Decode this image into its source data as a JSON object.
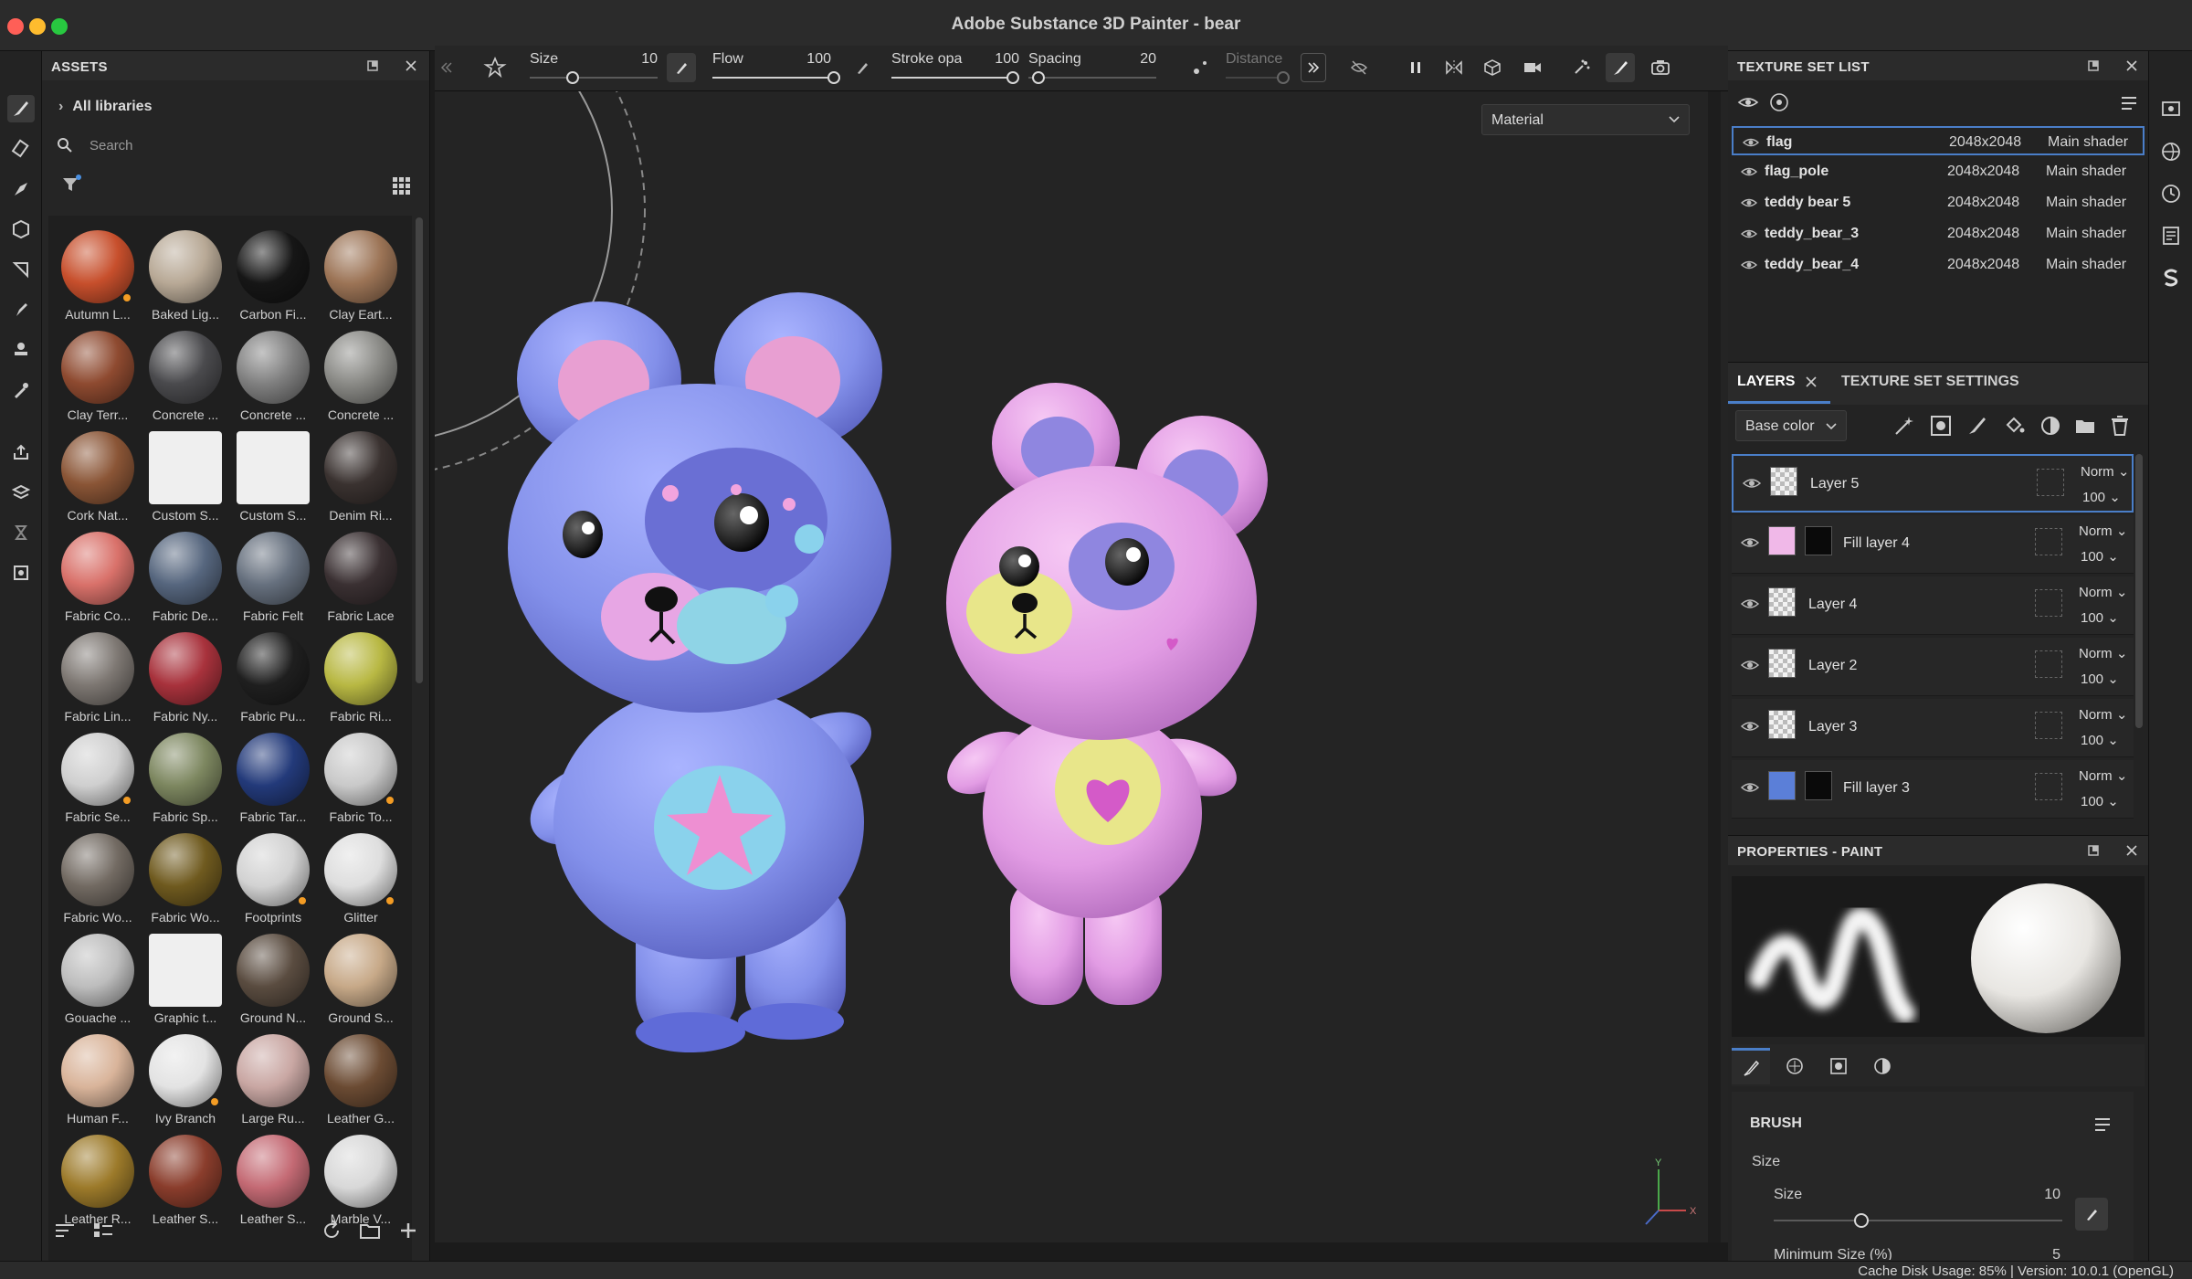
{
  "window": {
    "title": "Adobe Substance 3D Painter - bear"
  },
  "assets": {
    "title": "ASSETS",
    "libraries_label": "All libraries",
    "search_placeholder": "Search",
    "items": [
      {
        "label": "Autumn L...",
        "color": "#c74f2c",
        "badge": true
      },
      {
        "label": "Baked Lig...",
        "color": "#b8a996",
        "badge": false
      },
      {
        "label": "Carbon Fi...",
        "color": "#161616",
        "badge": false
      },
      {
        "label": "Clay Eart...",
        "color": "#9c7456",
        "badge": false
      },
      {
        "label": "Clay Terr...",
        "color": "#8e4a30",
        "badge": false
      },
      {
        "label": "Concrete ...",
        "color": "#4a4a4d",
        "badge": false
      },
      {
        "label": "Concrete ...",
        "color": "#808080",
        "badge": false
      },
      {
        "label": "Concrete ...",
        "color": "#8a8a86",
        "badge": false
      },
      {
        "label": "Cork Nat...",
        "color": "#8a5536",
        "badge": false
      },
      {
        "label": "Custom S...",
        "color": "#efefef",
        "badge": false,
        "square": true
      },
      {
        "label": "Custom S...",
        "color": "#efefef",
        "badge": false,
        "square": true
      },
      {
        "label": "Denim Ri...",
        "color": "#3a3230",
        "badge": false
      },
      {
        "label": "Fabric Co...",
        "color": "#d9716a",
        "badge": false
      },
      {
        "label": "Fabric De...",
        "color": "#56667e",
        "badge": false
      },
      {
        "label": "Fabric Felt",
        "color": "#66707e",
        "badge": false
      },
      {
        "label": "Fabric Lace",
        "color": "#3a3032",
        "badge": false
      },
      {
        "label": "Fabric Lin...",
        "color": "#7d7772",
        "badge": false
      },
      {
        "label": "Fabric Ny...",
        "color": "#a8323c",
        "badge": false
      },
      {
        "label": "Fabric Pu...",
        "color": "#1f1f1f",
        "badge": false
      },
      {
        "label": "Fabric Ri...",
        "color": "#b8b843",
        "badge": false
      },
      {
        "label": "Fabric Se...",
        "color": "#cfcfcf",
        "badge": true
      },
      {
        "label": "Fabric Sp...",
        "color": "#7d8760",
        "badge": false
      },
      {
        "label": "Fabric Tar...",
        "color": "#233a7a",
        "badge": false
      },
      {
        "label": "Fabric To...",
        "color": "#c9c9c9",
        "badge": true
      },
      {
        "label": "Fabric Wo...",
        "color": "#726a62",
        "badge": false
      },
      {
        "label": "Fabric Wo...",
        "color": "#6f5a1f",
        "badge": false
      },
      {
        "label": "Footprints",
        "color": "#d2d2d2",
        "badge": true
      },
      {
        "label": "Glitter",
        "color": "#dedede",
        "badge": true
      },
      {
        "label": "Gouache ...",
        "color": "#bdbdbd",
        "badge": false
      },
      {
        "label": "Graphic t...",
        "color": "#efefef",
        "badge": false,
        "square": true
      },
      {
        "label": "Ground N...",
        "color": "#5a4c40",
        "badge": false
      },
      {
        "label": "Ground S...",
        "color": "#c7a988",
        "badge": false
      },
      {
        "label": "Human F...",
        "color": "#d9b49a",
        "badge": false
      },
      {
        "label": "Ivy Branch",
        "color": "#e3e3e3",
        "badge": true
      },
      {
        "label": "Large Ru...",
        "color": "#c9a7a3",
        "badge": false
      },
      {
        "label": "Leather G...",
        "color": "#6b4b33",
        "badge": false
      },
      {
        "label": "Leather R...",
        "color": "#9c7a2a",
        "badge": false
      },
      {
        "label": "Leather S...",
        "color": "#8a3d2c",
        "badge": false
      },
      {
        "label": "Leather S...",
        "color": "#c46a74",
        "badge": false
      },
      {
        "label": "Marble V...",
        "color": "#d8d8d8",
        "badge": false
      }
    ]
  },
  "toolbar": {
    "size_label": "Size",
    "size_value": "10",
    "flow_label": "Flow",
    "flow_value": "100",
    "stroke_label": "Stroke opa",
    "stroke_value": "100",
    "spacing_label": "Spacing",
    "spacing_value": "20",
    "distance_label": "Distance"
  },
  "viewport": {
    "material_mode": "Material"
  },
  "texture_sets": {
    "title": "TEXTURE SET LIST",
    "rows": [
      {
        "name": "flag",
        "resolution": "2048x2048",
        "shader": "Main shader",
        "selected": true
      },
      {
        "name": "flag_pole",
        "resolution": "2048x2048",
        "shader": "Main shader",
        "selected": false
      },
      {
        "name": "teddy bear 5",
        "resolution": "2048x2048",
        "shader": "Main shader",
        "selected": false
      },
      {
        "name": "teddy_bear_3",
        "resolution": "2048x2048",
        "shader": "Main shader",
        "selected": false
      },
      {
        "name": "teddy_bear_4",
        "resolution": "2048x2048",
        "shader": "Main shader",
        "selected": false
      }
    ]
  },
  "layers": {
    "tab_layers": "LAYERS",
    "tab_settings": "TEXTURE SET SETTINGS",
    "channel": "Base color",
    "rows": [
      {
        "name": "Layer 5",
        "blend": "Norm",
        "opacity": "100",
        "thumb": "checker",
        "mask": false,
        "selected": true
      },
      {
        "name": "Fill layer 4",
        "blend": "Norm",
        "opacity": "100",
        "thumb": "#f0b8e8",
        "mask": true,
        "selected": false
      },
      {
        "name": "Layer 4",
        "blend": "Norm",
        "opacity": "100",
        "thumb": "checker",
        "mask": false,
        "selected": false
      },
      {
        "name": "Layer 2",
        "blend": "Norm",
        "opacity": "100",
        "thumb": "checker",
        "mask": false,
        "selected": false
      },
      {
        "name": "Layer 3",
        "blend": "Norm",
        "opacity": "100",
        "thumb": "checker",
        "mask": false,
        "selected": false
      },
      {
        "name": "Fill layer 3",
        "blend": "Norm",
        "opacity": "100",
        "thumb": "#5b7fd8",
        "mask": true,
        "selected": false
      }
    ]
  },
  "properties": {
    "title": "PROPERTIES - PAINT",
    "brush_title": "BRUSH",
    "size_section": "Size",
    "size_label": "Size",
    "size_value": "10",
    "min_size_label": "Minimum Size (%)",
    "min_size_value": "5"
  },
  "status": {
    "text": "Cache Disk Usage:     85%  |  Version: 10.0.1 (OpenGL)"
  }
}
